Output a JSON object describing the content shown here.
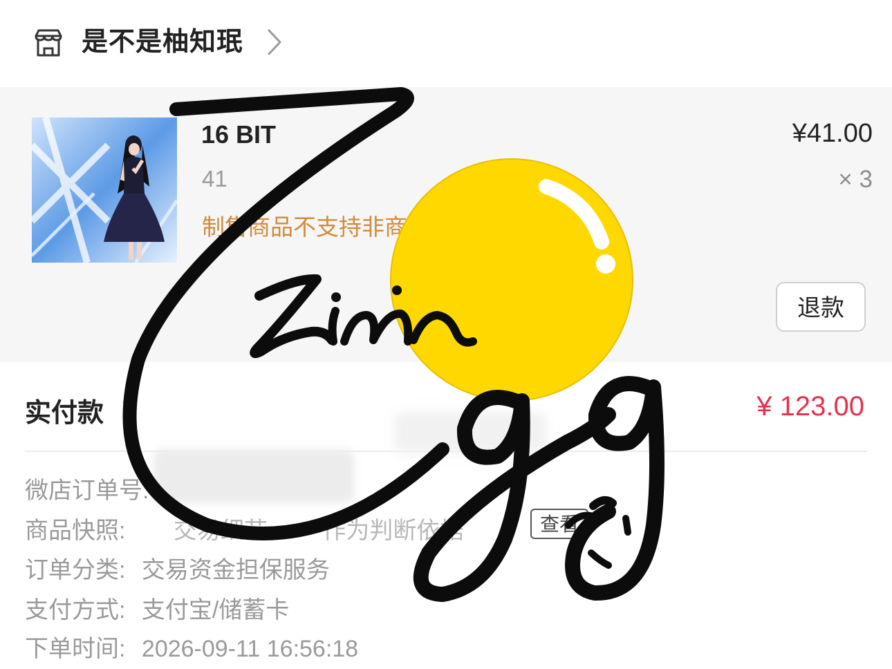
{
  "shop": {
    "name": "是不是柚知珉",
    "icon": "shop-icon"
  },
  "product": {
    "title": "16 BIT",
    "spec": "41",
    "notice": "制售商品不支持非商",
    "price": "¥41.00",
    "qty": "× 3",
    "refund_label": "退款"
  },
  "payment": {
    "label": "实付款",
    "amount": "¥ 123.00",
    "amount_color": "#e8304d"
  },
  "details": {
    "order_no_label": "微店订单号:",
    "snapshot_label": "商品快照:",
    "snapshot_value": "交易细节",
    "snapshot_value2": "作为判断依据",
    "view_label": "查看",
    "category_label": "订单分类:",
    "category_value": "交易资金担保服务",
    "pay_method_label": "支付方式:",
    "pay_method_value": "支付宝/储蓄卡",
    "order_time_label": "下单时间:",
    "order_time_value": "2026-09-11 16:56:18"
  },
  "overlay": {
    "signature_text": "Zinin gg",
    "sticker_color": "#ffd800"
  }
}
